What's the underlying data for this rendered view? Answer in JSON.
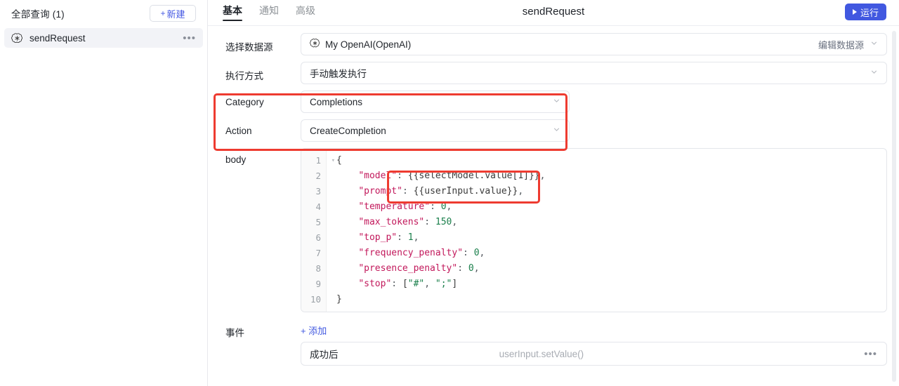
{
  "sidebar": {
    "title": "全部查询 (1)",
    "new_button": {
      "plus": "+",
      "label": "新建"
    },
    "items": [
      {
        "icon": "openai-icon",
        "label": "sendRequest",
        "menu": "•••"
      }
    ]
  },
  "topbar": {
    "tabs": [
      {
        "label": "基本",
        "active": true
      },
      {
        "label": "通知",
        "active": false
      },
      {
        "label": "高级",
        "active": false
      }
    ],
    "title": "sendRequest",
    "run_button": {
      "label": "运行",
      "icon": "play-icon",
      "color": "#4158e0"
    }
  },
  "form": {
    "datasource": {
      "label": "选择数据源",
      "value": "My OpenAI(OpenAI)",
      "icon": "openai-icon",
      "edit_link": "编辑数据源",
      "chevron": "chevron-down-icon"
    },
    "execution": {
      "label": "执行方式",
      "value": "手动触发执行",
      "chevron": "chevron-down-icon"
    },
    "category": {
      "label": "Category",
      "value": "Completions",
      "chevron": "chevron-down-icon"
    },
    "action": {
      "label": "Action",
      "value": "CreateCompletion",
      "chevron": "chevron-down-icon"
    },
    "body": {
      "label": "body",
      "lines": [
        {
          "no": "1",
          "fold": "▾",
          "text": "{"
        },
        {
          "no": "2",
          "fold": "",
          "text": "    \"model\": {{selectModel.value[1]}},"
        },
        {
          "no": "3",
          "fold": "",
          "text": "    \"prompt\": {{userInput.value}},"
        },
        {
          "no": "4",
          "fold": "",
          "text": "    \"temperature\": 0,"
        },
        {
          "no": "5",
          "fold": "",
          "text": "    \"max_tokens\": 150,"
        },
        {
          "no": "6",
          "fold": "",
          "text": "    \"top_p\": 1,"
        },
        {
          "no": "7",
          "fold": "",
          "text": "    \"frequency_penalty\": 0,"
        },
        {
          "no": "8",
          "fold": "",
          "text": "    \"presence_penalty\": 0,"
        },
        {
          "no": "9",
          "fold": "",
          "text": "    \"stop\": [\"#\", \";\"]"
        },
        {
          "no": "10",
          "fold": "",
          "text": "}"
        }
      ]
    },
    "events": {
      "label": "事件",
      "add_label": "+ 添加",
      "rows": [
        {
          "name": "成功后",
          "handler": "userInput.setValue()",
          "menu": "•••"
        }
      ]
    }
  },
  "annotations": {
    "color": "#ee3b30",
    "boxes": [
      "category-action-highlight",
      "code-binding-highlight"
    ]
  }
}
